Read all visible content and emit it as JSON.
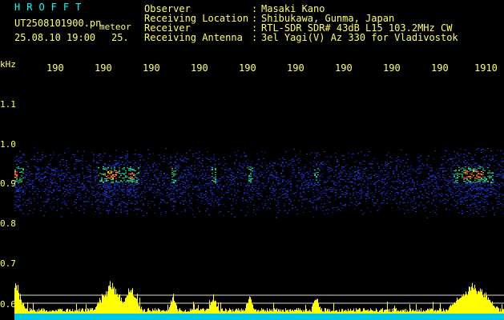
{
  "header": {
    "title": "HROFFT",
    "filename": "UT2508101900.pn",
    "detector": "meteor",
    "date": "25.08.10 19:00",
    "count": "25.",
    "fields": [
      {
        "label": "Observer",
        "value": "Masaki Kano"
      },
      {
        "label": "Receiving Location",
        "value": "Shibukawa, Gunma, Japan"
      },
      {
        "label": "Receiver",
        "value": "RTL-SDR SDR# 43dB L15 103.2MHz CW"
      },
      {
        "label": "Receiving Antenna",
        "value": "3el Yagi(V) Az 330 for Vladivostok"
      }
    ]
  },
  "axes": {
    "y_unit": "kHz",
    "y_ticks": [
      "1.1",
      "1.0",
      "0.9",
      "0.8",
      "0.7",
      "0.6"
    ],
    "x_ticks": [
      "190",
      "190",
      "190",
      "190",
      "190",
      "190",
      "190",
      "190",
      "190",
      "1910"
    ]
  },
  "colors": {
    "text": "#ffff66",
    "title": "#00ffff",
    "bars": "#ffff00",
    "baseline": "#00ffff"
  }
}
